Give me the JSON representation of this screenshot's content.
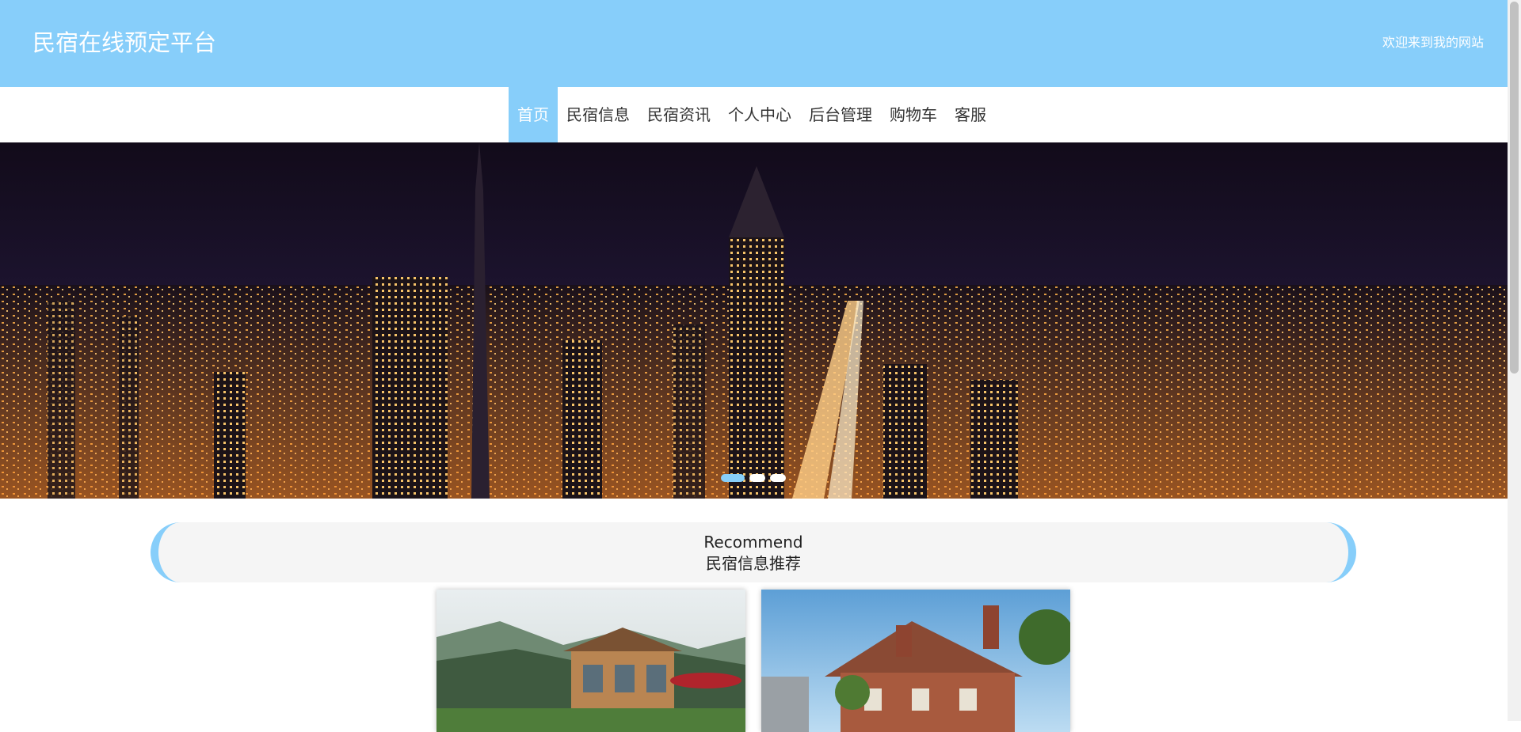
{
  "header": {
    "site_title": "民宿在线预定平台",
    "welcome": "欢迎来到我的网站",
    "background_color": "#87cefa"
  },
  "nav": {
    "items": [
      {
        "label": "首页",
        "active": true
      },
      {
        "label": "民宿信息"
      },
      {
        "label": "民宿资讯"
      },
      {
        "label": "个人中心"
      },
      {
        "label": "后台管理"
      },
      {
        "label": "购物车"
      },
      {
        "label": "客服"
      }
    ],
    "active_color": "#87cefa"
  },
  "banner": {
    "image": "night-city-skyline-image",
    "slide_count": 3,
    "active_slide": 1
  },
  "recommend": {
    "title_en": "Recommend",
    "title_cn": "民宿信息推荐"
  },
  "cards": [
    {
      "image": "wooden-villa-mountain-image"
    },
    {
      "image": "brick-cottage-garden-image"
    }
  ]
}
